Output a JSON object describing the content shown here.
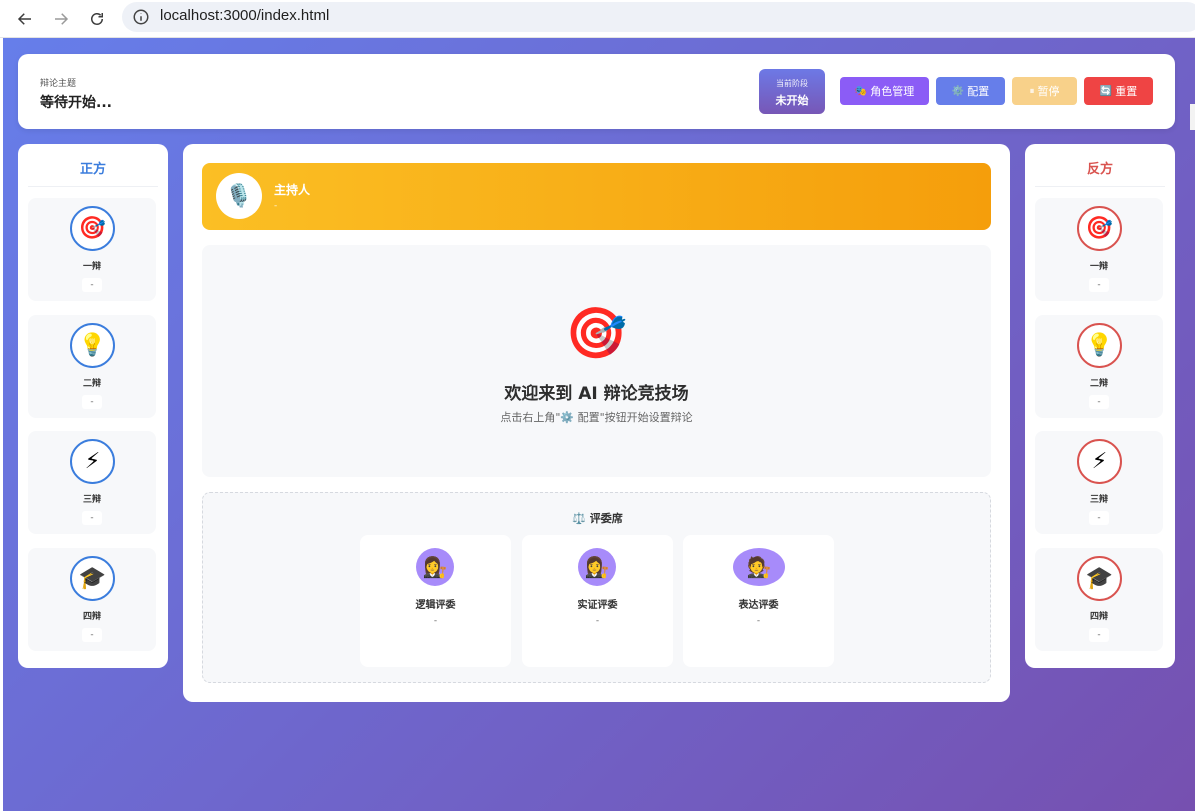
{
  "browser": {
    "url": "localhost:3000/index.html"
  },
  "header": {
    "topic_label": "辩论主题",
    "topic_value": "等待开始...",
    "phase_label": "当前阶段",
    "phase_value": "未开始",
    "buttons": {
      "roles": {
        "icon": "🎭",
        "label": "角色管理"
      },
      "config": {
        "icon": "⚙️",
        "label": "配置"
      },
      "pause": {
        "icon": "⏸",
        "label": "暂停"
      },
      "reset": {
        "icon": "🔄",
        "label": "重置"
      }
    }
  },
  "affirmative": {
    "title": "正方",
    "color": "#3b7ddd",
    "debaters": [
      {
        "icon": "🎯",
        "name": "一辩",
        "model": "-"
      },
      {
        "icon": "💡",
        "name": "二辩",
        "model": "-"
      },
      {
        "icon": "⚡",
        "name": "三辩",
        "model": "-"
      },
      {
        "icon": "🎓",
        "name": "四辩",
        "model": "-"
      }
    ]
  },
  "negative": {
    "title": "反方",
    "color": "#d9534f",
    "debaters": [
      {
        "icon": "🎯",
        "name": "一辩",
        "model": "-"
      },
      {
        "icon": "💡",
        "name": "二辩",
        "model": "-"
      },
      {
        "icon": "⚡",
        "name": "三辩",
        "model": "-"
      },
      {
        "icon": "🎓",
        "name": "四辩",
        "model": "-"
      }
    ]
  },
  "host": {
    "icon": "🎙️",
    "name": "主持人",
    "model": "-"
  },
  "welcome": {
    "icon": "🎯",
    "title": "欢迎来到 AI 辩论竞技场",
    "hint": "点击右上角\"⚙️ 配置\"按钮开始设置辩论"
  },
  "judges": {
    "title": "⚖️ 评委席",
    "items": [
      {
        "icon": "👩‍⚖️",
        "name": "逻辑评委",
        "model": "-"
      },
      {
        "icon": "👩‍⚖️",
        "name": "实证评委",
        "model": "-"
      },
      {
        "icon": "🧑‍⚖️",
        "name": "表达评委",
        "model": "-"
      }
    ]
  },
  "colors": {
    "background_start": "#667eea",
    "background_end": "#7650b0",
    "host_start": "#fbbf24",
    "host_end": "#f59e0b",
    "roles_button": "#8b5cf6",
    "config_button": "#667eea",
    "pause_button": "#f8d18a",
    "reset_button": "#ef4444"
  }
}
